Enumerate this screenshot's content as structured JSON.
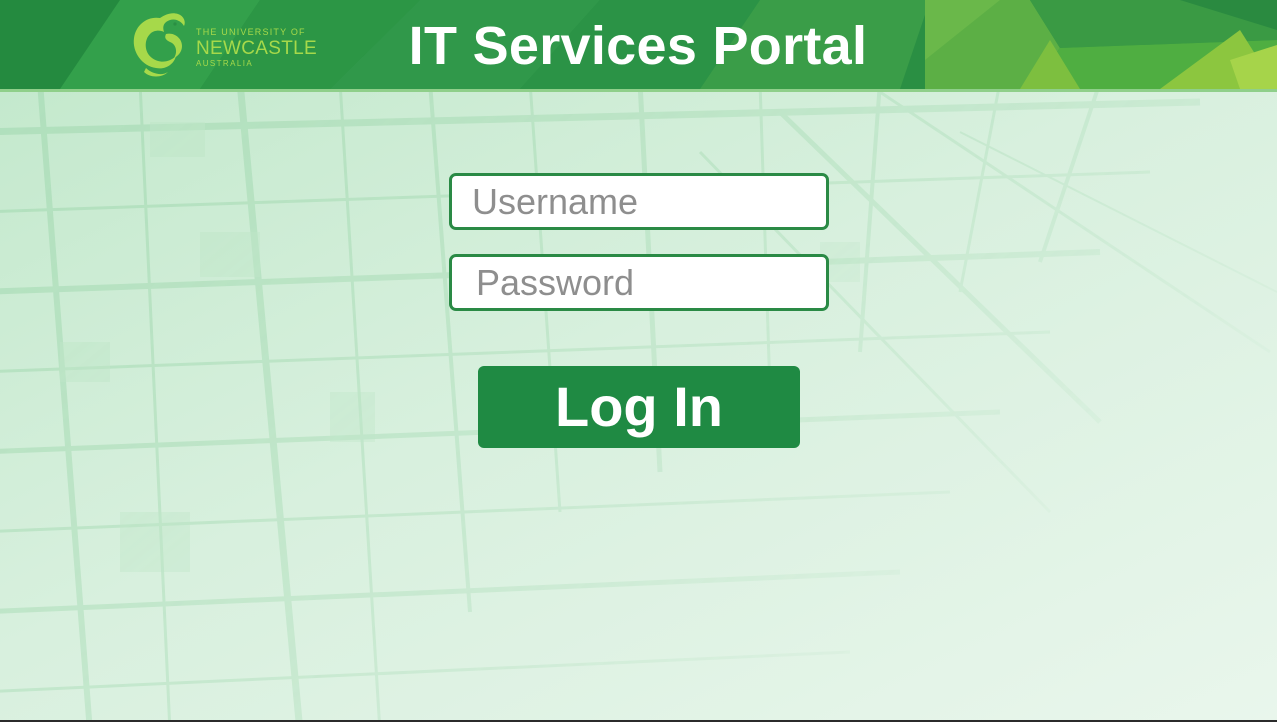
{
  "header": {
    "title": "IT Services Portal",
    "logo": {
      "icon": "seahorse-logo-icon",
      "line1": "THE UNIVERSITY OF",
      "line2": "NEWCASTLE",
      "line3": "AUSTRALIA"
    }
  },
  "login_form": {
    "username": {
      "value": "",
      "placeholder": "Username"
    },
    "password": {
      "value": "",
      "placeholder": "Password"
    },
    "submit_label": "Log In"
  },
  "colors": {
    "header_green": "#2d9445",
    "header_light_green": "#8cc63f",
    "logo_green": "#a6d94a",
    "button_green": "#1f8a43",
    "field_border": "#2a8a45",
    "background": "#e6f5ea"
  }
}
